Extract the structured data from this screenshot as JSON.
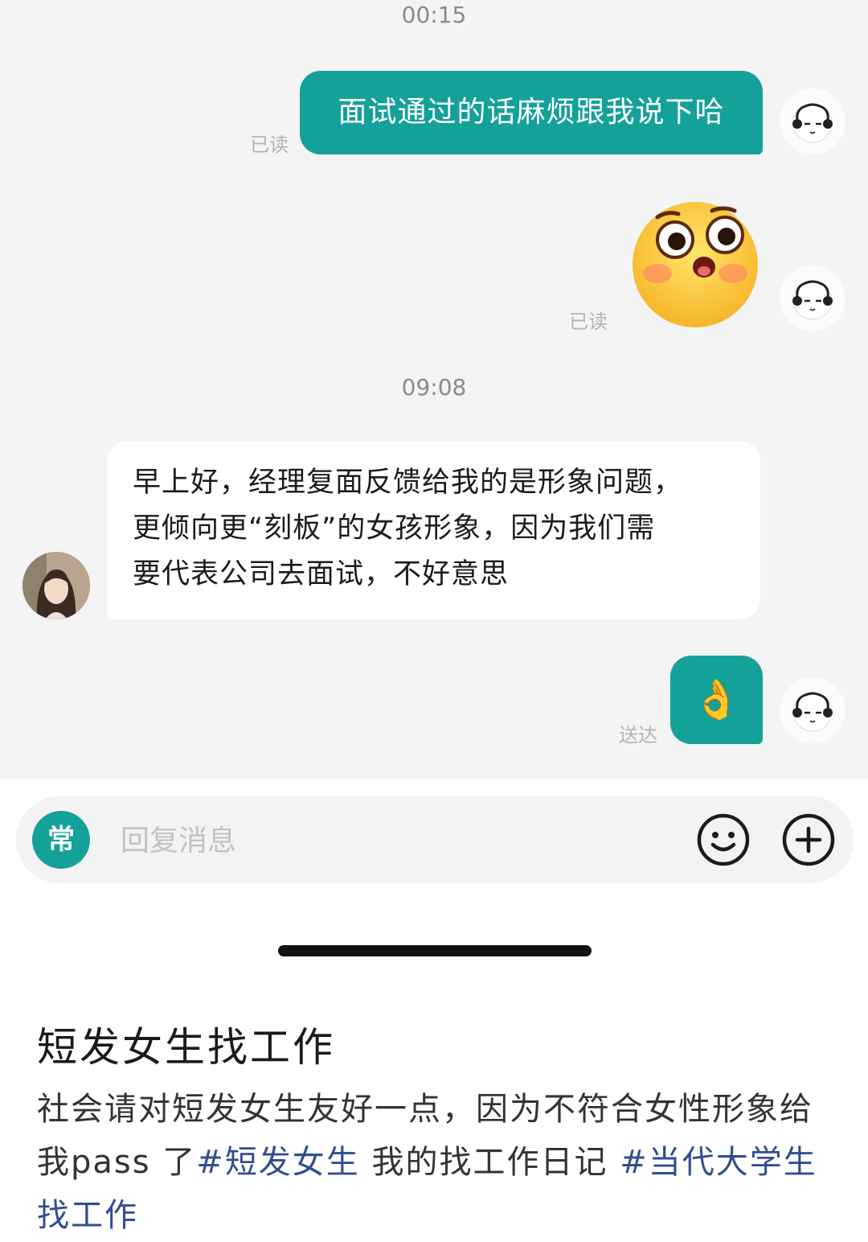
{
  "chat": {
    "time1": "00:15",
    "time2": "09:08",
    "messages": [
      {
        "from": "me",
        "type": "text",
        "text": "面试通过的话麻烦跟我说下哈",
        "status": "已读"
      },
      {
        "from": "me",
        "type": "emoji",
        "emoji": "surprised-face-emoji",
        "status": "已读"
      },
      {
        "from": "other",
        "type": "text",
        "lines": [
          "早上好，经理复面反馈给我的是形象问题，",
          "更倾向更“刻板”的女孩形象，因为我们需",
          "要代表公司去面试，不好意思"
        ]
      },
      {
        "from": "me",
        "type": "emoji",
        "emoji": "ok-hand-emoji",
        "text": "👌",
        "status": "送达"
      }
    ]
  },
  "input_bar": {
    "frequent_label": "常",
    "placeholder": "回复消息",
    "emoji_icon": "smiley-icon",
    "plus_icon": "plus-circle-icon"
  },
  "post": {
    "title": "短发女生找工作",
    "body_text": "社会请对短发女生友好一点，因为不符合女性形象给我pass 了",
    "hashtag1": "#短发女生",
    "middle_text": " 我的找工作日记 ",
    "hashtag2": "#当代大学生找工作"
  },
  "colors": {
    "accent": "#14a19a",
    "chat_bg": "#f4f4f4",
    "hashtag": "#2f4f8f"
  }
}
